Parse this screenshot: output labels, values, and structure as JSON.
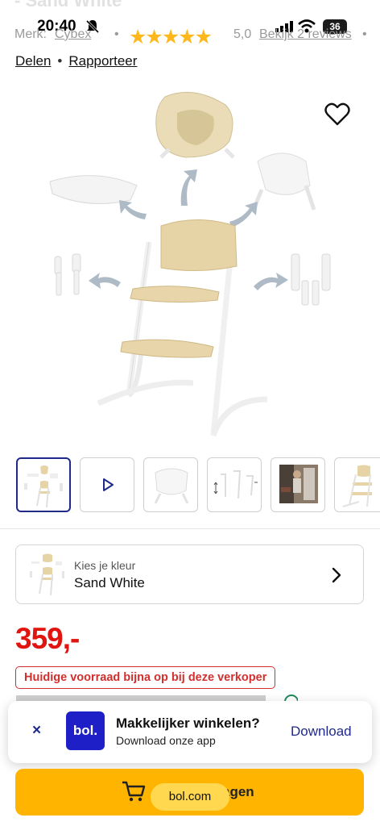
{
  "header": {
    "title_peek": "- Sand White",
    "time": "20:40",
    "battery": "36"
  },
  "meta": {
    "brand_label": "Merk:",
    "brand": "Cybex",
    "stars": "★★★★★",
    "rating": "5,0",
    "reviews_link": "Bekijk 2 reviews",
    "separator": "•"
  },
  "actions": {
    "share": "Delen",
    "report": "Rapporteer",
    "separator": "•"
  },
  "icons": {
    "wishlist": "heart-icon",
    "video": "play-icon",
    "close": "close-icon",
    "cart": "cart-icon",
    "chevron": "chevron-right-icon"
  },
  "thumbnails": [
    {
      "kind": "image",
      "label": "highchair-set",
      "active": true
    },
    {
      "kind": "video",
      "label": "video",
      "active": false
    },
    {
      "kind": "image",
      "label": "baby-seat",
      "active": false
    },
    {
      "kind": "image",
      "label": "adjustments",
      "active": false
    },
    {
      "kind": "image",
      "label": "lifestyle",
      "active": false
    },
    {
      "kind": "image",
      "label": "chair",
      "active": false
    }
  ],
  "color_selector": {
    "prompt": "Kies je kleur",
    "value": "Sand White"
  },
  "price": "359,-",
  "stock_badge": "Huidige voorraad bijna op bij deze verkoper",
  "app_banner": {
    "close": "×",
    "logo": "bol.",
    "title": "Makkelijker winkelen?",
    "subtitle": "Download onze app",
    "download": "Download"
  },
  "cart": {
    "label": "In winkelwagen",
    "url_pill": "bol.com"
  },
  "colors": {
    "brand_blue": "#1f2a8a",
    "price_red": "#e0150f",
    "cart_yellow": "#ffb400",
    "star_yellow": "#ffb81c",
    "wood": "#e6d3a6"
  }
}
